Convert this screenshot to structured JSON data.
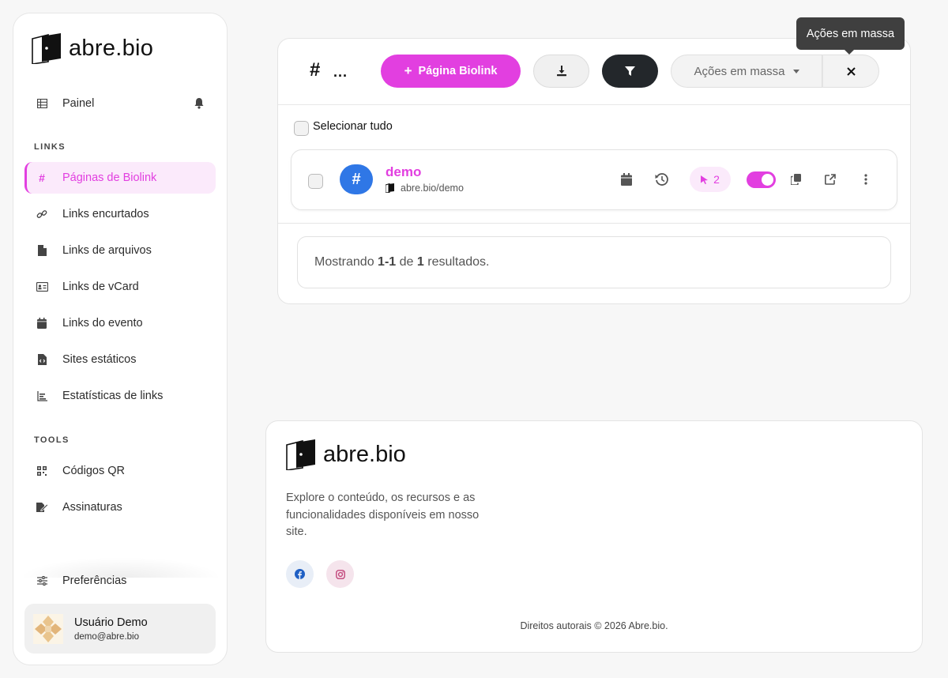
{
  "brand": {
    "name": "abre.bio",
    "accent": "#e23fe0"
  },
  "sidebar": {
    "dashboard_label": "Painel",
    "section_links": "LINKS",
    "links": [
      {
        "label": "Páginas de Biolink",
        "icon": "hashtag-icon",
        "active": true
      },
      {
        "label": "Links encurtados",
        "icon": "link-icon"
      },
      {
        "label": "Links de arquivos",
        "icon": "file-icon"
      },
      {
        "label": "Links de vCard",
        "icon": "id-card-icon"
      },
      {
        "label": "Links do evento",
        "icon": "calendar-icon"
      },
      {
        "label": "Sites estáticos",
        "icon": "file-code-icon"
      },
      {
        "label": "Estatísticas de links",
        "icon": "chart-icon"
      }
    ],
    "section_tools": "TOOLS",
    "tools": [
      {
        "label": "Códigos QR",
        "icon": "qrcode-icon"
      },
      {
        "label": "Assinaturas",
        "icon": "signature-icon"
      }
    ],
    "preferences_label": "Preferências",
    "user": {
      "name": "Usuário Demo",
      "email": "demo@abre.bio"
    }
  },
  "toolbar": {
    "title_symbol": "#",
    "title_dots": "...",
    "new_button": "Página Biolink",
    "new_button_icon": "+",
    "mass_actions": "Ações em massa",
    "close_symbol": "×",
    "tooltip": "Ações em massa"
  },
  "list": {
    "select_all": "Selecionar tudo",
    "items": [
      {
        "name": "demo",
        "url": "abre.bio/demo",
        "badge": "#",
        "clicks": "2",
        "enabled": true
      }
    ]
  },
  "results": {
    "prefix": "Mostrando",
    "range": "1-1",
    "of": "de",
    "total": "1",
    "suffix": "resultados."
  },
  "footer": {
    "description": "Explore o conteúdo, os recursos e as funcionalidades disponíveis em nosso site.",
    "copyright": "Direitos autorais © 2026 Abre.bio."
  }
}
